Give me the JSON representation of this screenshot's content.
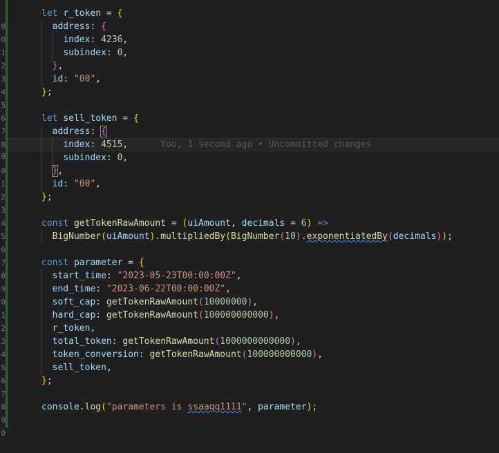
{
  "gutter": {
    "line_numbers": [
      "9",
      "0",
      "1",
      "2",
      "3",
      "4",
      "5",
      "6",
      "7",
      "8",
      "9",
      "0",
      "1",
      "2",
      "3",
      "4",
      "5",
      "6",
      "7",
      "8",
      "9",
      "0",
      "1",
      "2",
      "3",
      "4",
      "5",
      "6",
      "7",
      "8",
      "9",
      "0"
    ]
  },
  "code": {
    "r_token": {
      "decl_kw": "let",
      "name": "r_token",
      "op": " = ",
      "open": "{",
      "address_key": "address",
      "colon": ": ",
      "address_open": "{",
      "index_key": "index",
      "index_val": "4236",
      "subindex_key": "subindex",
      "subindex_val": "0",
      "address_close": "}",
      "id_key": "id",
      "id_val": "\"00\"",
      "close": "}"
    },
    "sell_token": {
      "decl_kw": "let",
      "name": "sell_token",
      "op": " = ",
      "open": "{",
      "address_key": "address",
      "address_open": "{",
      "index_key": "index",
      "index_val": "4515",
      "subindex_key": "subindex",
      "subindex_val": "0",
      "address_close": "}",
      "id_key": "id",
      "id_val": "\"00\"",
      "close": "}"
    },
    "blame": "You, 1 second ago • Uncommitted changes",
    "getTokenRawAmount": {
      "decl_kw": "const",
      "name": "getTokenRawAmount",
      "op": " = ",
      "param1": "uiAmount",
      "param2": "decimals",
      "default_val": "6",
      "arrow": "=>",
      "call_fn": "BigNumber",
      "call_arg": "uiAmount",
      "method1": "multipliedBy",
      "inner_fn": "BigNumber",
      "inner_arg": "10",
      "method2": "exponentiatedBy",
      "method2_arg": "decimals"
    },
    "parameter": {
      "decl_kw": "const",
      "name": "parameter",
      "op": " = ",
      "open": "{",
      "start_key": "start_time",
      "start_val": "\"2023-05-23T00:00:00Z\"",
      "end_key": "end_time",
      "end_val": "\"2023-06-22T00:00:00Z\"",
      "soft_key": "soft_cap",
      "soft_fn": "getTokenRawAmount",
      "soft_val": "10000000",
      "hard_key": "hard_cap",
      "hard_fn": "getTokenRawAmount",
      "hard_val": "100000000000",
      "r_token": "r_token",
      "total_key": "total_token",
      "total_fn": "getTokenRawAmount",
      "total_val": "1000000000000",
      "conv_key": "token_conversion",
      "conv_fn": "getTokenRawAmount",
      "conv_val": "100000000000",
      "sell_token": "sell_token",
      "close": "}"
    },
    "console_line": {
      "obj": "console",
      "method": "log",
      "str_pre": "\"parameters is ",
      "str_sq": "ssaaqq1111",
      "str_post": "\"",
      "arg2": "parameter"
    }
  },
  "colors": {
    "background": "#1f1f1f",
    "keyword": "#569cd6",
    "variable": "#9cdcfe",
    "function": "#dcdcaa",
    "number": "#b5cea8",
    "string": "#ce9178",
    "bracket_gold": "#ffd700",
    "bracket_purple": "#da70d6",
    "bracket_blue": "#179fff",
    "git_added": "#2b6a2e"
  }
}
